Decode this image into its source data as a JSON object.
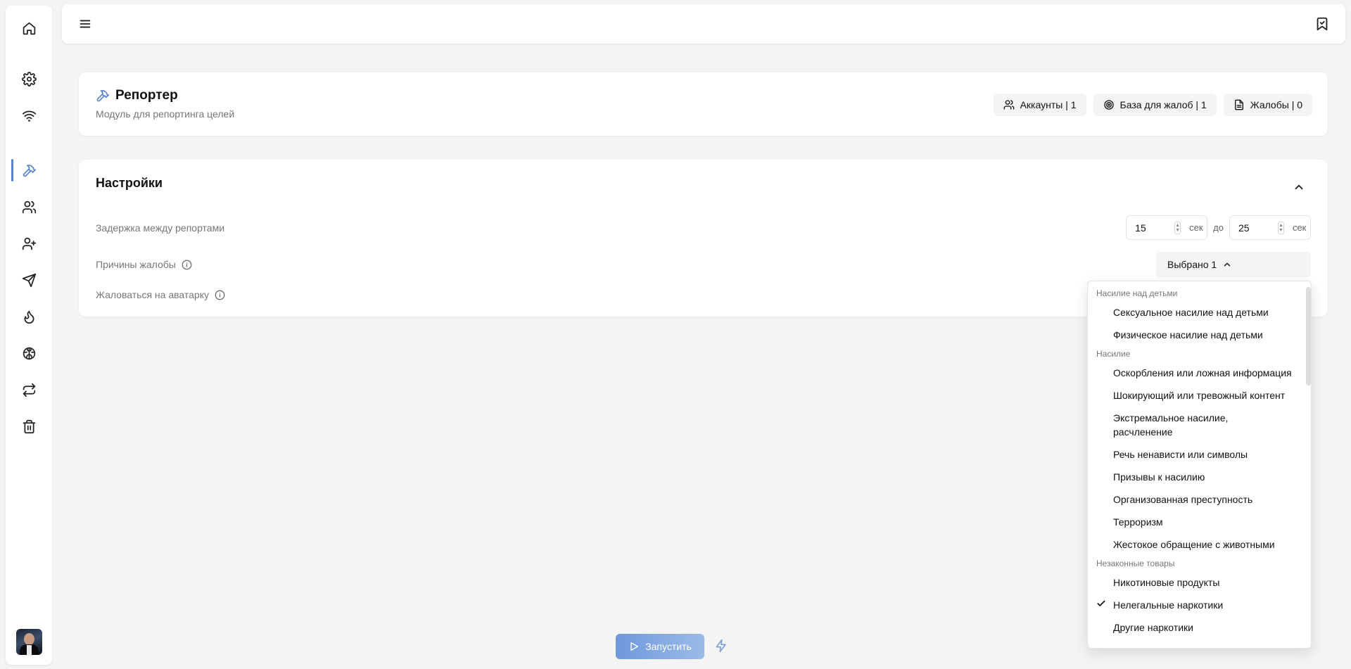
{
  "colors": {
    "accent": "#5b84c9",
    "background": "#f4f4f5",
    "card": "#ffffff"
  },
  "sidebar": {
    "items": [
      {
        "name": "home",
        "icon": "home-icon"
      },
      {
        "name": "settings",
        "icon": "gear-icon"
      },
      {
        "name": "wifi",
        "icon": "wifi-icon"
      },
      {
        "name": "reporter",
        "icon": "hammer-icon",
        "active": true
      },
      {
        "name": "users",
        "icon": "users-icon"
      },
      {
        "name": "add-user",
        "icon": "user-plus-icon"
      },
      {
        "name": "send",
        "icon": "send-icon"
      },
      {
        "name": "fire",
        "icon": "flame-icon"
      },
      {
        "name": "brain",
        "icon": "brain-icon"
      },
      {
        "name": "repeat",
        "icon": "repeat-icon"
      },
      {
        "name": "trash",
        "icon": "trash-icon"
      }
    ]
  },
  "header": {
    "title": "Репортер",
    "subtitle": "Модуль для репортинга целей",
    "chips": {
      "accounts": "Аккаунты | 1",
      "base": "База для жалоб | 1",
      "reports": "Жалобы | 0"
    }
  },
  "settings": {
    "title": "Настройки",
    "delay_label": "Задержка между репортами",
    "delay_from": "15",
    "delay_to": "25",
    "unit": "сек",
    "to": "до",
    "reasons_label": "Причины жалобы",
    "reasons_selected": "Выбрано 1",
    "avatar_label": "Жаловаться на аватарку"
  },
  "dropdown": {
    "groups": [
      {
        "label": "Насилие над детьми",
        "items": [
          {
            "label": "Сексуальное насилие над детьми",
            "checked": false
          },
          {
            "label": "Физическое насилие над детьми",
            "checked": false
          }
        ]
      },
      {
        "label": "Насилие",
        "items": [
          {
            "label": "Оскорбления или ложная информация",
            "checked": false
          },
          {
            "label": "Шокирующий или тревожный контент",
            "checked": false
          },
          {
            "label": "Экстремальное насилие, расчленение",
            "checked": false
          },
          {
            "label": "Речь ненависти или символы",
            "checked": false
          },
          {
            "label": "Призывы к насилию",
            "checked": false
          },
          {
            "label": "Организованная преступность",
            "checked": false
          },
          {
            "label": "Терроризм",
            "checked": false
          },
          {
            "label": "Жестокое обращение с животными",
            "checked": false
          }
        ]
      },
      {
        "label": "Незаконные товары",
        "items": [
          {
            "label": "Никотиновые продукты",
            "checked": false
          },
          {
            "label": "Нелегальные наркотики",
            "checked": true
          },
          {
            "label": "Другие наркотики",
            "checked": false
          }
        ]
      }
    ]
  },
  "footer": {
    "run_label": "Запустить"
  }
}
